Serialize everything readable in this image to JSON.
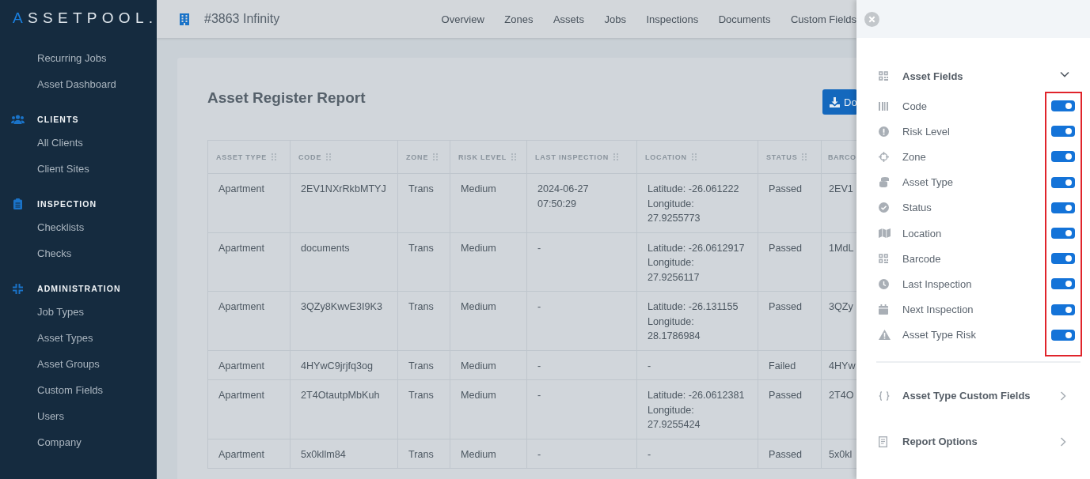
{
  "sidebar": {
    "logo": "ASSETPOOL.",
    "groups": [
      {
        "items": [
          "Recurring Jobs",
          "Asset Dashboard"
        ]
      },
      {
        "heading": "CLIENTS",
        "items": [
          "All Clients",
          "Client Sites"
        ]
      },
      {
        "heading": "INSPECTION",
        "items": [
          "Checklists",
          "Checks"
        ]
      },
      {
        "heading": "ADMINISTRATION",
        "items": [
          "Job Types",
          "Asset Types",
          "Asset Groups",
          "Custom Fields",
          "Users",
          "Company"
        ]
      }
    ]
  },
  "topbar": {
    "title": "#3863 Infinity",
    "nav": [
      "Overview",
      "Zones",
      "Assets",
      "Jobs",
      "Inspections",
      "Documents",
      "Custom Fields"
    ]
  },
  "report": {
    "title": "Asset Register Report",
    "download_button": "Do",
    "table": {
      "columns": [
        "ASSET TYPE",
        "CODE",
        "ZONE",
        "RISK LEVEL",
        "LAST INSPECTION",
        "LOCATION",
        "STATUS",
        "BARCO"
      ],
      "rows": [
        [
          "Apartment",
          "2EV1NXrRkbMTYJ",
          "Trans",
          "Medium",
          "2024-06-27 07:50:29",
          "Latitude: -26.061222\nLongitude:\n27.9255773",
          "Passed",
          "2EV1"
        ],
        [
          "Apartment",
          "documents",
          "Trans",
          "Medium",
          "-",
          "Latitude: -26.0612917\nLongitude:\n27.9256117",
          "Passed",
          "1MdL"
        ],
        [
          "Apartment",
          "3QZy8KwvE3I9K3",
          "Trans",
          "Medium",
          "-",
          "Latitude: -26.131155\nLongitude:\n28.1786984",
          "Passed",
          "3QZy"
        ],
        [
          "Apartment",
          "4HYwC9jrjfq3og",
          "Trans",
          "Medium",
          "-",
          "-",
          "Failed",
          "4HYw"
        ],
        [
          "Apartment",
          "2T4OtautpMbKuh",
          "Trans",
          "Medium",
          "-",
          "Latitude: -26.0612381\nLongitude:\n27.9255424",
          "Passed",
          "2T4O"
        ],
        [
          "Apartment",
          "5x0kllm84",
          "Trans",
          "Medium",
          "-",
          "-",
          "Passed",
          "5x0kl"
        ]
      ]
    }
  },
  "panel": {
    "sections": [
      {
        "title": "Asset Fields",
        "expanded": true,
        "highlighted": true,
        "fields": [
          {
            "label": "Code",
            "on": true
          },
          {
            "label": "Risk Level",
            "on": true
          },
          {
            "label": "Zone",
            "on": true
          },
          {
            "label": "Asset Type",
            "on": true
          },
          {
            "label": "Status",
            "on": true
          },
          {
            "label": "Location",
            "on": true
          },
          {
            "label": "Barcode",
            "on": true
          },
          {
            "label": "Last Inspection",
            "on": true
          },
          {
            "label": "Next Inspection",
            "on": true
          },
          {
            "label": "Asset Type Risk",
            "on": true
          }
        ]
      },
      {
        "title": "Asset Type Custom Fields",
        "expanded": false
      },
      {
        "title": "Report Options",
        "expanded": false
      }
    ]
  }
}
